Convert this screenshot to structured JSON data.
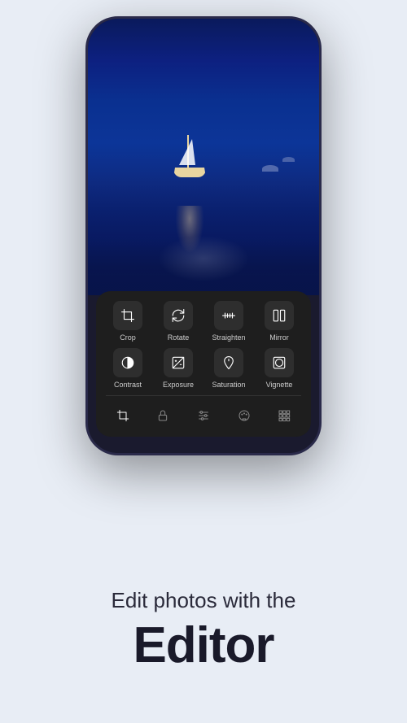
{
  "phone": {
    "tools_row1": [
      {
        "id": "crop",
        "label": "Crop",
        "icon": "crop"
      },
      {
        "id": "rotate",
        "label": "Rotate",
        "icon": "rotate"
      },
      {
        "id": "straighten",
        "label": "Straighten",
        "icon": "straighten"
      },
      {
        "id": "mirror",
        "label": "Mirror",
        "icon": "mirror"
      }
    ],
    "tools_row2": [
      {
        "id": "contrast",
        "label": "Contrast",
        "icon": "contrast"
      },
      {
        "id": "exposure",
        "label": "Exposure",
        "icon": "exposure"
      },
      {
        "id": "saturation",
        "label": "Saturation",
        "icon": "saturation"
      },
      {
        "id": "vignette",
        "label": "Vignette",
        "icon": "vignette"
      }
    ],
    "nav_items": [
      {
        "id": "crop-nav",
        "active": true
      },
      {
        "id": "lock-nav",
        "active": false
      },
      {
        "id": "tune-nav",
        "active": false
      },
      {
        "id": "palette-nav",
        "active": false
      },
      {
        "id": "grid-nav",
        "active": false
      }
    ]
  },
  "text": {
    "subtitle": "Edit photos with the",
    "title": "Editor"
  }
}
